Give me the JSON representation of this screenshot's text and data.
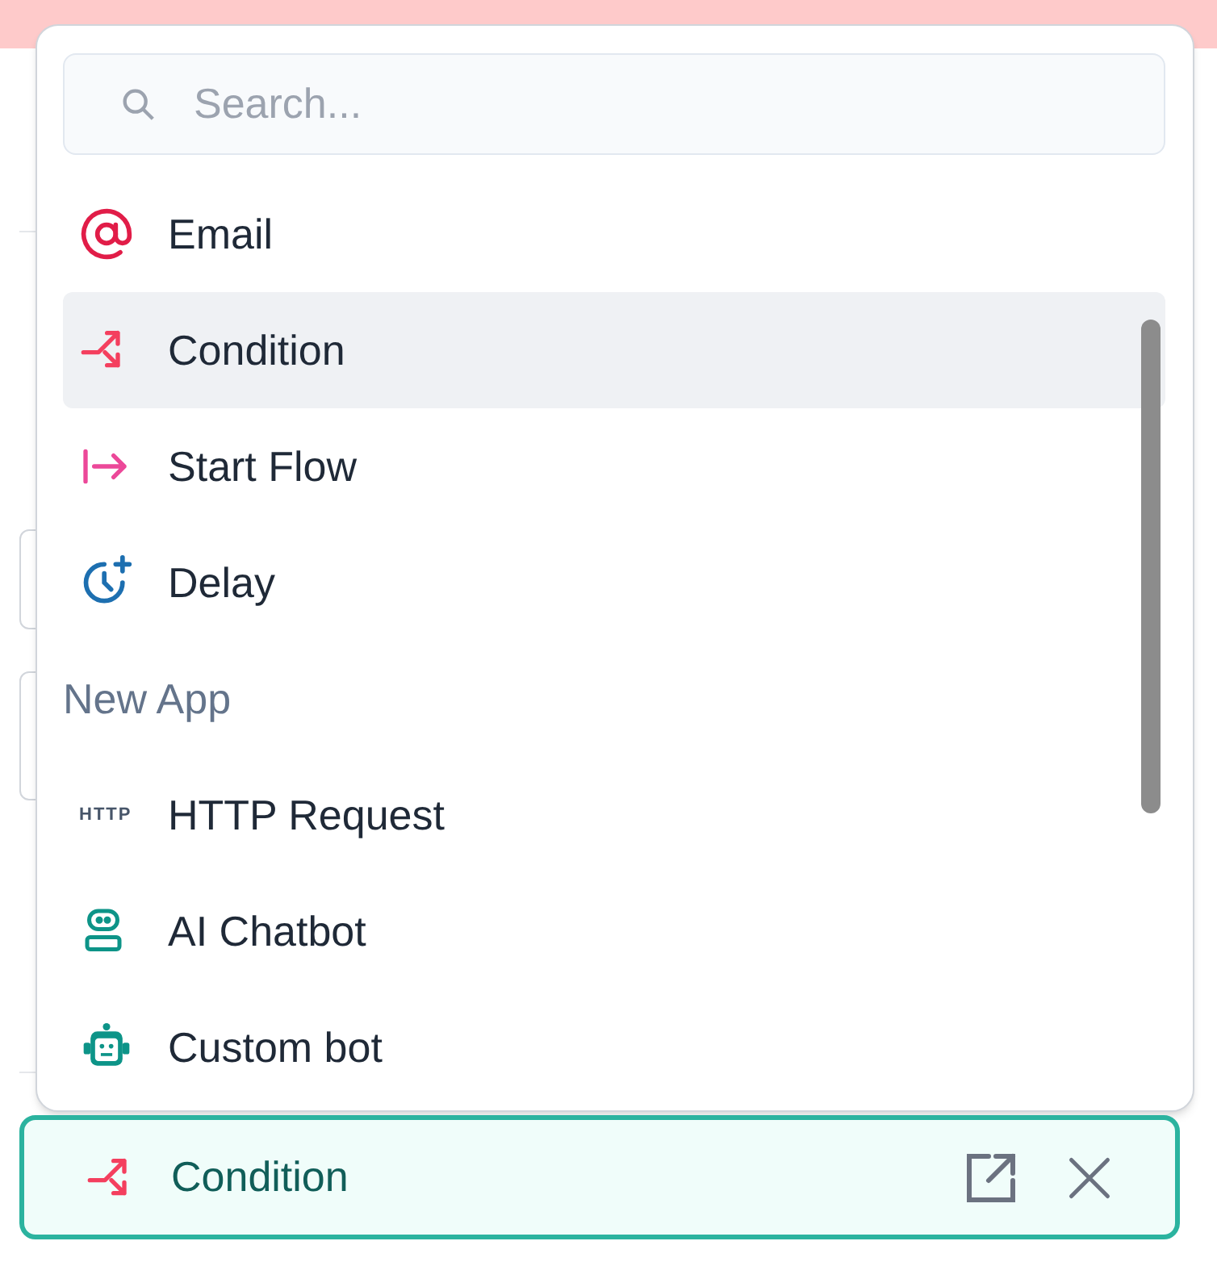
{
  "search": {
    "placeholder": "Search..."
  },
  "menu": {
    "items": [
      {
        "kind": "email",
        "label": "Email",
        "selected": false
      },
      {
        "kind": "condition",
        "label": "Condition",
        "selected": true
      },
      {
        "kind": "start-flow",
        "label": "Start Flow",
        "selected": false
      },
      {
        "kind": "delay",
        "label": "Delay",
        "selected": false
      },
      {
        "kind": "header",
        "label": "New App"
      },
      {
        "kind": "http",
        "icon_text": "HTTP",
        "label": "HTTP Request",
        "selected": false
      },
      {
        "kind": "ai-chatbot",
        "label": "AI Chatbot",
        "selected": false
      },
      {
        "kind": "custom-bot",
        "label": "Custom bot",
        "selected": false
      }
    ]
  },
  "chosen": {
    "kind": "condition",
    "label": "Condition"
  }
}
